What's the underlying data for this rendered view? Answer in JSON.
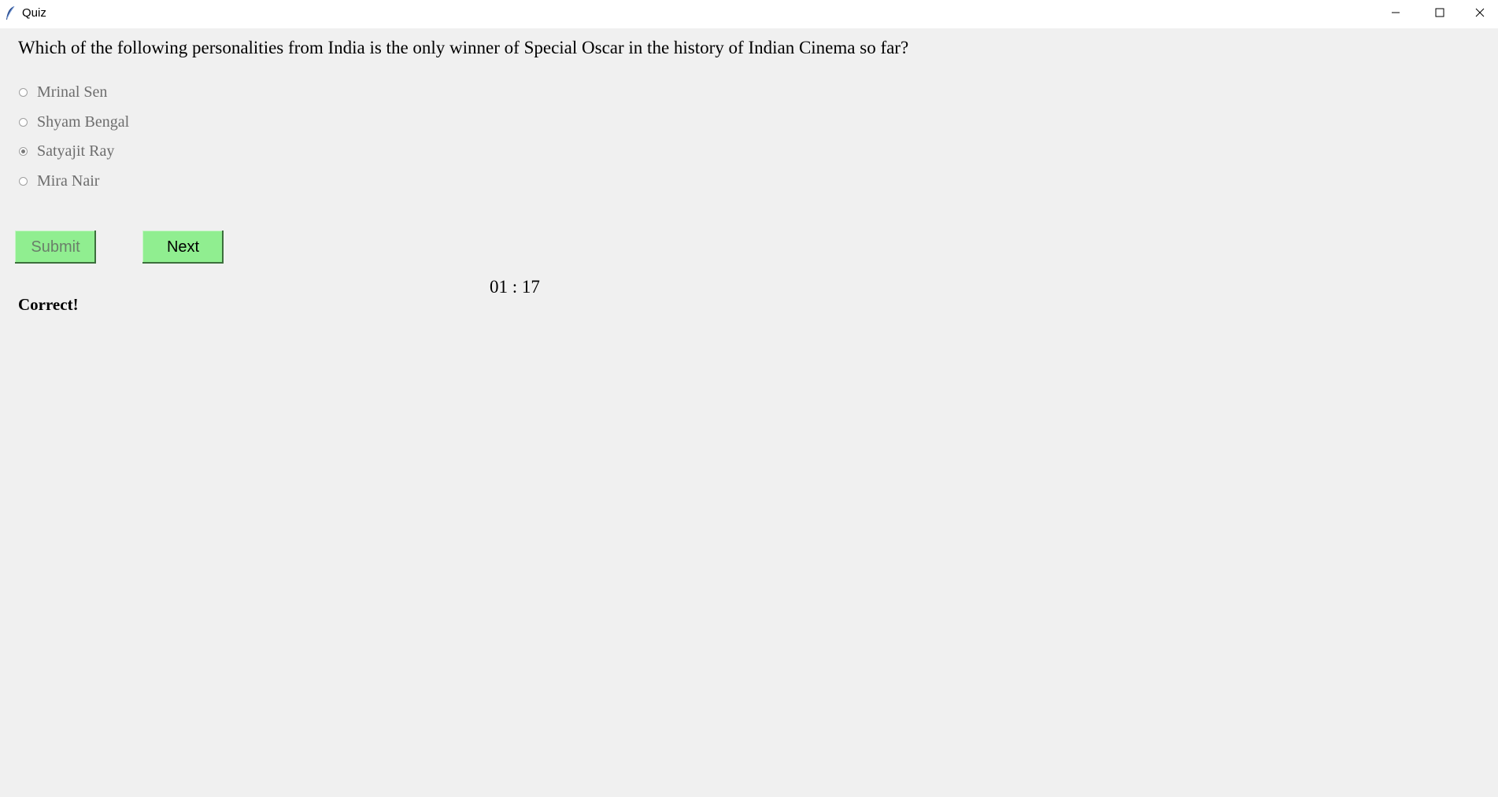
{
  "window": {
    "title": "Quiz",
    "icon": "feather-icon",
    "controls": [
      "minimize-icon",
      "maximize-icon",
      "close-icon"
    ]
  },
  "question": "Which of the following personalities from India is the only winner of Special Oscar in the history of Indian Cinema so far?",
  "options": [
    {
      "label": "Mrinal Sen",
      "selected": false
    },
    {
      "label": "Shyam Bengal",
      "selected": false
    },
    {
      "label": "Satyajit Ray",
      "selected": true
    },
    {
      "label": "Mira Nair",
      "selected": false
    }
  ],
  "buttons": {
    "submit_label": "Submit",
    "submit_enabled": false,
    "next_label": "Next",
    "color": "#90ee90"
  },
  "timer": "01 : 17",
  "feedback": "Correct!",
  "colors": {
    "background": "#f0f0f0",
    "titlebar": "#ffffff",
    "disabled_text": "#6d6d6d"
  }
}
